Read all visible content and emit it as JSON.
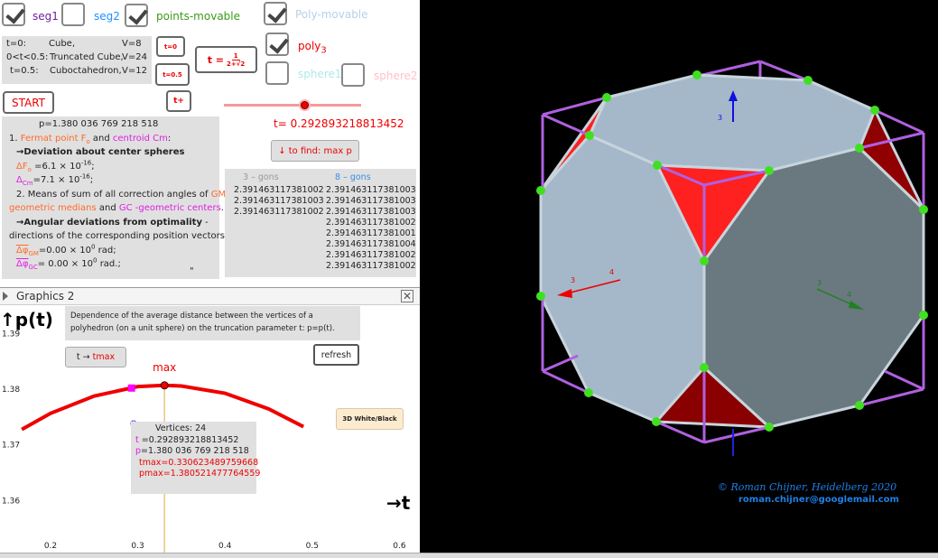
{
  "checkboxes": {
    "seg1": {
      "label": "seg1",
      "checked": true,
      "color": "#7020a0"
    },
    "seg2": {
      "label": "seg2",
      "checked": false,
      "color": "#1e90ff"
    },
    "points_movable": {
      "label": "points-movable",
      "checked": true,
      "color": "#3a9a1a"
    },
    "poly_movable": {
      "label": "Poly-movable",
      "checked": true,
      "color": "#b8d0e8"
    },
    "poly3": {
      "label": "poly",
      "sub": "3",
      "checked": true,
      "color": "#ee0000"
    },
    "sphere1": {
      "label": "sphere1",
      "checked": false,
      "color": "#b0e8e8"
    },
    "sphere2": {
      "label": "sphere2",
      "checked": false,
      "color": "#ffc0cb"
    }
  },
  "info": {
    "rows": [
      [
        "t=0:",
        "Cube,",
        "V=8"
      ],
      [
        "0<t<0.5:",
        "Truncated Cube,",
        "V=24"
      ],
      [
        "t=0.5:",
        "Cuboctahedron,",
        "V=12"
      ]
    ]
  },
  "buttons": {
    "t0": "t=0",
    "t05": "t=0.5",
    "tplus": "t+",
    "formula_lhs": "t =",
    "formula_num": "1",
    "formula_den": "2+√2",
    "start": "START",
    "find_max": "↓ to find: max p",
    "t_to_tmax_a": "t →",
    "t_to_tmax_b": "tmax",
    "refresh": "refresh",
    "white_black": "3D White/Black"
  },
  "slider": {
    "value": 0.292893218813452,
    "min": 0,
    "max": 0.5,
    "label": "t= 0.292893218813452"
  },
  "text_panel": {
    "p": "p=1.380 036 769 218 518",
    "l1a": "1.",
    "l1b": "Fermat point  F",
    "l1c": "o",
    "l1d": " and ",
    "l1e": "centroid Cm",
    "l2": "→Deviation about center spheres",
    "dF": "ΔF",
    "dFsub": "o",
    "dFval": " =6.1 × 10",
    "exp16": "-16",
    "dC": "Δ",
    "dCsub": "Cm",
    "dCval": "=7.1 × 10",
    "l5a": "2. Means of sum of all correction angles of ",
    "l5b": "GM-",
    "l6a": "geometric medians",
    "l6b": " and ",
    "l6c": "GC -geometric centers",
    "l7": "→Angular deviations from optimality",
    "l7b": " -",
    "l8": "directions of the corresponding position vectors:",
    "phiGM": "Δφ",
    "phiGMsub": "GM",
    "phiGMval": "=0.00 × 10",
    "exp0": "0",
    "rad1": "  rad;",
    "phiGC": "Δφ",
    "phiGCsub": "GC",
    "phiGCval": "= 0.00 × 10",
    "rad2": " rad.;",
    "quote": "\""
  },
  "gons": {
    "h3": "3 – gons",
    "h8": "8 – gons",
    "c3": [
      "2.391463117381002",
      "2.391463117381003",
      "2.391463117381002"
    ],
    "c8": [
      "2.391463117381003",
      "2.391463117381003",
      "2.391463117381003",
      "2.391463117381002",
      "2.391463117381001",
      "2.391463117381004",
      "2.391463117381002",
      "2.391463117381002"
    ]
  },
  "graphics2": {
    "title": "Graphics 2",
    "desc1": "Dependence of the average distance between the vertices of a",
    "desc2": "polyhedron (on a unit sphere) on the truncation parameter t: p=p(t).",
    "max_label": "max",
    "vbox": {
      "v": "Vertices: 24",
      "t_lbl": "t",
      "t_val": " =0.292893218813452",
      "p_lbl": "p",
      "p_val": "=1.380 036 769 218 518",
      "tmax": "tmax=0.330623489759668",
      "pmax": "pmax=1.380521477764559"
    }
  },
  "chart_data": {
    "type": "line",
    "xlabel": "→t",
    "ylabel": "↑p(t)",
    "xlim": [
      0.167,
      0.6
    ],
    "ylim": [
      1.355,
      1.392
    ],
    "xticks": [
      "0.2",
      "0.3",
      "0.4",
      "0.5",
      "0.6"
    ],
    "yticks": [
      "1.39",
      "1.38",
      "1.37",
      "1.36"
    ],
    "series": [
      {
        "x": [
          0.167,
          0.2,
          0.25,
          0.3,
          0.3306,
          0.35,
          0.4,
          0.45,
          0.49
        ],
        "y": [
          1.3726,
          1.3755,
          1.3786,
          1.3803,
          1.38052,
          1.3804,
          1.3791,
          1.3763,
          1.3731
        ],
        "color": "#ee0000"
      }
    ],
    "points": {
      "current": {
        "t": 0.292893218813452,
        "p": 1.380036769218518,
        "color": "#ff00ff"
      },
      "max": {
        "t": 0.330623489759668,
        "p": 1.380521477764559,
        "color": "#ee0000"
      }
    }
  },
  "view3d": {
    "axis_labels": [
      "3",
      "4",
      "3",
      "3",
      "4"
    ],
    "credit1": "©   Roman Chijner, Heidelberg 2020",
    "credit2": "roman.chijner@googlemail.com"
  }
}
